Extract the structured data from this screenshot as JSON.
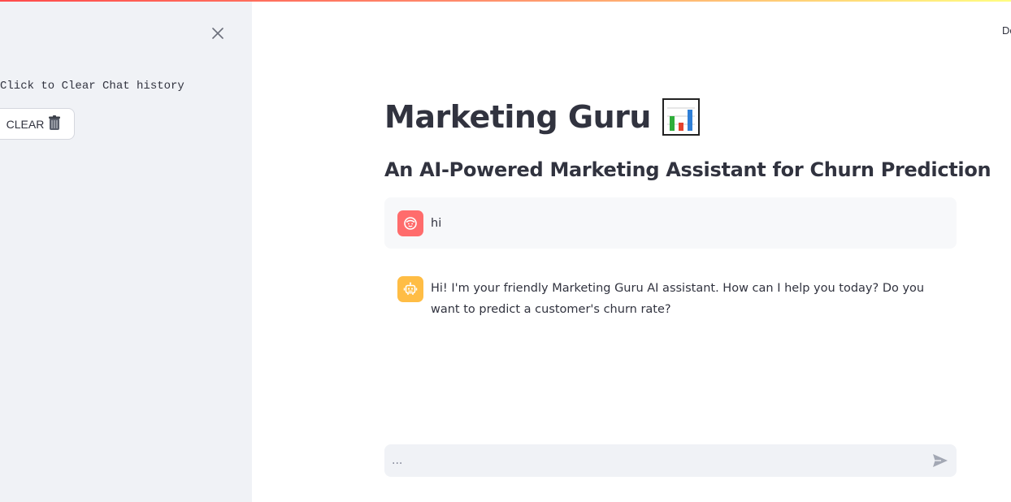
{
  "sidebar": {
    "hint": "Click to Clear Chat history",
    "clear_label": "CLEAR",
    "clear_icon": "🗑️"
  },
  "header": {
    "deploy_fragment": "De"
  },
  "main": {
    "title": "Marketing Guru",
    "subtitle": "An AI-Powered Marketing Assistant for Churn Prediction"
  },
  "messages": [
    {
      "role": "user",
      "text": "hi"
    },
    {
      "role": "assistant",
      "text": "Hi! I'm your friendly Marketing Guru AI assistant. How can I help you today? Do you want to predict a customer's churn rate?"
    }
  ],
  "chat_input": {
    "placeholder": "...",
    "value": ""
  },
  "colors": {
    "sidebar_bg": "#f0f2f6",
    "user_avatar": "#ff6c6c",
    "bot_avatar": "#ffbd45",
    "text": "#31333f"
  }
}
